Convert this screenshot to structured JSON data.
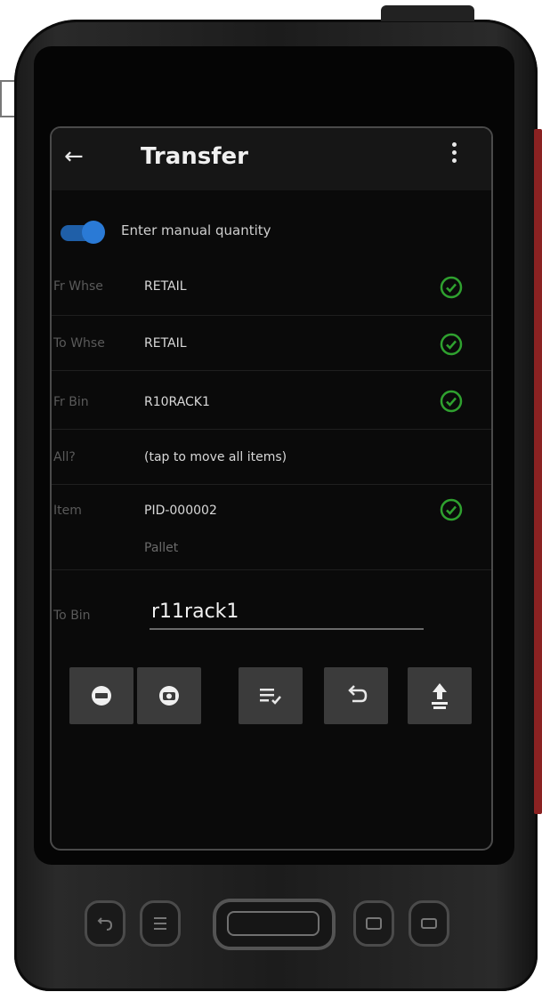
{
  "app": {
    "title": "Transfer"
  },
  "manual_quantity": {
    "label": "Enter manual quantity",
    "enabled": true
  },
  "fields": [
    {
      "label": "Fr Whse",
      "value": "RETAIL",
      "sub": "",
      "validated": true
    },
    {
      "label": "To Whse",
      "value": "RETAIL",
      "sub": "",
      "validated": true
    },
    {
      "label": "Fr Bin",
      "value": "R10RACK1",
      "sub": "",
      "validated": true
    },
    {
      "label": "All?",
      "value": "(tap to move all items)",
      "sub": "",
      "validated": false
    },
    {
      "label": "Item",
      "value": "PID-000002",
      "sub": "Pallet",
      "validated": true
    }
  ],
  "to_bin": {
    "label": "To Bin",
    "value": "r11rack1"
  },
  "toolbar": [
    {
      "name": "scan-button"
    },
    {
      "name": "camera-button"
    },
    {
      "name": "list-check-button"
    },
    {
      "name": "undo-button"
    },
    {
      "name": "submit-button"
    }
  ],
  "colors": {
    "accent": "#2a7ad6",
    "check": "#2fa12f",
    "background": "#0a0a0a",
    "button": "#3b3b3b"
  }
}
